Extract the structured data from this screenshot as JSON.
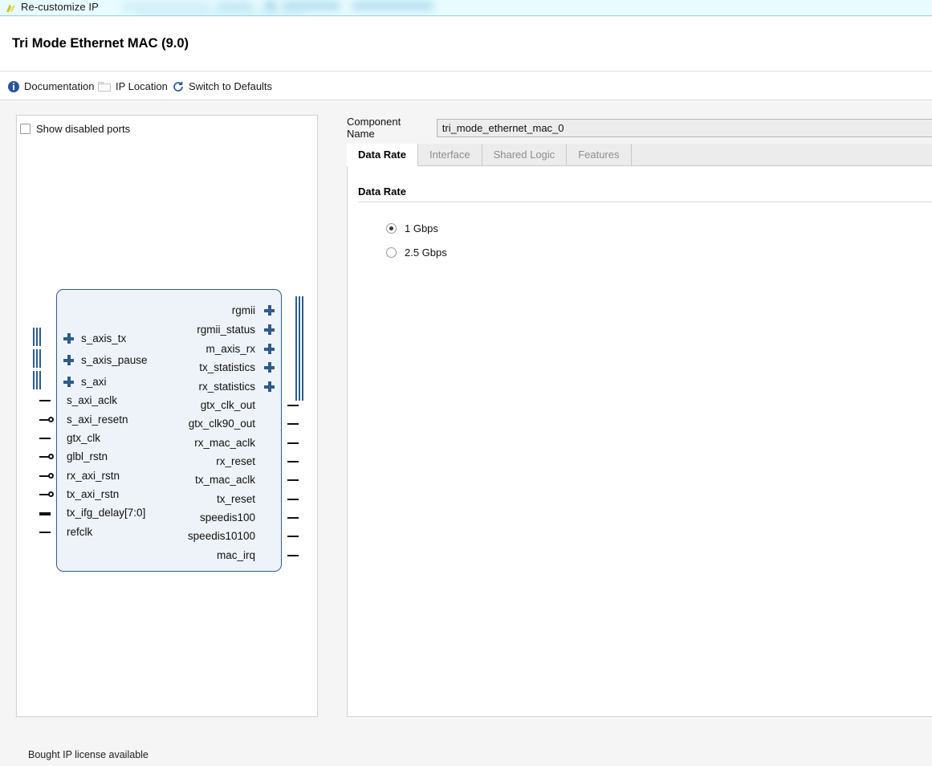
{
  "titlebar": {
    "text": "Re-customize IP",
    "icon": "vivado-logo-icon"
  },
  "header": {
    "title": "Tri Mode Ethernet MAC (9.0)"
  },
  "toolbar": {
    "documentation": "Documentation",
    "ip_location": "IP Location",
    "switch_to_defaults": "Switch to Defaults"
  },
  "left_panel": {
    "show_disabled_ports": "Show disabled ports",
    "show_disabled_ports_checked": false,
    "license_status": "Bought IP license available",
    "ports": {
      "left": [
        {
          "label": "s_axis_tx",
          "type": "bus"
        },
        {
          "label": "s_axis_pause",
          "type": "bus"
        },
        {
          "label": "s_axi",
          "type": "bus"
        },
        {
          "label": "s_axi_aclk",
          "type": "wire"
        },
        {
          "label": "s_axi_resetn",
          "type": "wire-low"
        },
        {
          "label": "gtx_clk",
          "type": "wire"
        },
        {
          "label": "glbl_rstn",
          "type": "wire-low"
        },
        {
          "label": "rx_axi_rstn",
          "type": "wire-low"
        },
        {
          "label": "tx_axi_rstn",
          "type": "wire-low"
        },
        {
          "label": "tx_ifg_delay[7:0]",
          "type": "wire"
        },
        {
          "label": "refclk",
          "type": "wire"
        }
      ],
      "right": [
        {
          "label": "rgmii",
          "type": "bus"
        },
        {
          "label": "rgmii_status",
          "type": "bus"
        },
        {
          "label": "m_axis_rx",
          "type": "bus"
        },
        {
          "label": "tx_statistics",
          "type": "bus"
        },
        {
          "label": "rx_statistics",
          "type": "bus"
        },
        {
          "label": "gtx_clk_out",
          "type": "wire"
        },
        {
          "label": "gtx_clk90_out",
          "type": "wire"
        },
        {
          "label": "rx_mac_aclk",
          "type": "wire"
        },
        {
          "label": "rx_reset",
          "type": "wire"
        },
        {
          "label": "tx_mac_aclk",
          "type": "wire"
        },
        {
          "label": "tx_reset",
          "type": "wire"
        },
        {
          "label": "speedis100",
          "type": "wire"
        },
        {
          "label": "speedis10100",
          "type": "wire"
        },
        {
          "label": "mac_irq",
          "type": "wire"
        }
      ]
    }
  },
  "right_panel": {
    "component_name_label": "Component Name",
    "component_name_value": "tri_mode_ethernet_mac_0",
    "tabs": [
      {
        "label": "Data Rate",
        "active": true
      },
      {
        "label": "Interface",
        "active": false
      },
      {
        "label": "Shared Logic",
        "active": false
      },
      {
        "label": "Features",
        "active": false
      }
    ],
    "section_title": "Data Rate",
    "options": [
      {
        "label": "1 Gbps",
        "selected": true
      },
      {
        "label": "2.5 Gbps",
        "selected": false
      }
    ]
  },
  "colors": {
    "titlebar_bg": "#e8fbff",
    "block_fill": "#eef3f9",
    "block_border": "#2e5c8a",
    "accent_blue": "#27549c"
  }
}
